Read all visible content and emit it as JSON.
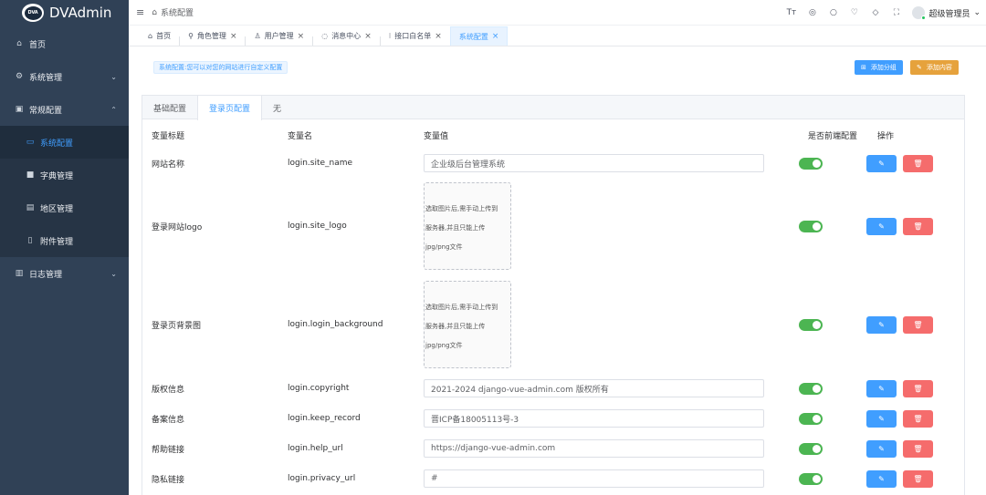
{
  "app": {
    "logo_badge": "DVA",
    "title": "DVAdmin"
  },
  "sidebar": {
    "items": [
      {
        "label": "首页",
        "icon": "home-icon"
      },
      {
        "label": "系统管理",
        "icon": "gear-icon"
      },
      {
        "label": "常规配置",
        "icon": "config-icon"
      },
      {
        "label": "系统配置",
        "icon": "settings-icon"
      },
      {
        "label": "字典管理",
        "icon": "dictionary-icon"
      },
      {
        "label": "地区管理",
        "icon": "map-icon"
      },
      {
        "label": "附件管理",
        "icon": "file-icon"
      },
      {
        "label": "日志管理",
        "icon": "log-icon"
      }
    ]
  },
  "header": {
    "breadcrumb": "系统配置",
    "user_name": "超级管理员"
  },
  "tabs": [
    {
      "label": "首页"
    },
    {
      "label": "角色管理"
    },
    {
      "label": "用户管理"
    },
    {
      "label": "消息中心"
    },
    {
      "label": "接口白名单"
    },
    {
      "label": "系统配置"
    }
  ],
  "main": {
    "notice": "系统配置:您可以对您的网站进行自定义配置",
    "add_group_label": "添加分组",
    "add_content_label": "添加内容",
    "config_tabs": [
      "基础配置",
      "登录页配置",
      "无"
    ],
    "columns": {
      "title": "变量标题",
      "key": "变量名",
      "value": "变量值",
      "frontend": "是否前端配置",
      "actions": "操作"
    },
    "upload_hint": [
      "选取图片后,需手动上传到",
      "服务器,并且只能上传",
      "jpg/png文件"
    ],
    "rows": [
      {
        "title": "网站名称",
        "key": "login.site_name",
        "value": "企业级后台管理系统",
        "frontend": true
      },
      {
        "title": "登录网站logo",
        "key": "login.site_logo",
        "value": "",
        "frontend": true
      },
      {
        "title": "登录页背景图",
        "key": "login.login_background",
        "value": "",
        "frontend": true
      },
      {
        "title": "版权信息",
        "key": "login.copyright",
        "value": "2021-2024 django-vue-admin.com 版权所有",
        "frontend": true
      },
      {
        "title": "备案信息",
        "key": "login.keep_record",
        "value": "晋ICP备18005113号-3",
        "frontend": true
      },
      {
        "title": "帮助链接",
        "key": "login.help_url",
        "value": "https://django-vue-admin.com",
        "frontend": true
      },
      {
        "title": "隐私链接",
        "key": "login.privacy_url",
        "value": "#",
        "frontend": true
      }
    ]
  }
}
